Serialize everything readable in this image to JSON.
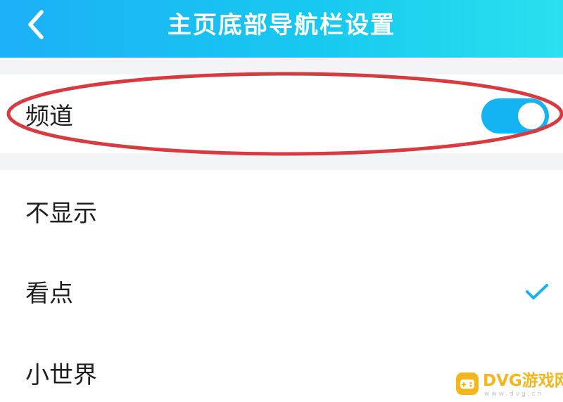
{
  "header": {
    "title": "主页底部导航栏设置",
    "back_icon": "chevron-left-icon"
  },
  "channel_setting": {
    "label": "频道",
    "toggle_on": true
  },
  "options": [
    {
      "label": "不显示",
      "selected": false
    },
    {
      "label": "看点",
      "selected": true
    },
    {
      "label": "小世界",
      "selected": false
    }
  ],
  "colors": {
    "header_gradient_start": "#1cb0f7",
    "header_gradient_end": "#2ae0ee",
    "accent": "#14b4f3",
    "annotation": "#d93a3f",
    "watermark": "#f4b51d"
  },
  "watermark": {
    "text": "DVG游戏网",
    "subtext": "www.dvg.cn"
  }
}
